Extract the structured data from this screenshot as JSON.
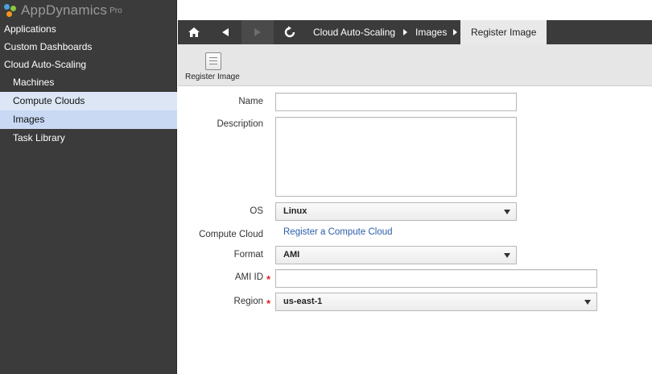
{
  "app": {
    "name": "AppDynamics",
    "edition": "Pro"
  },
  "sidebar": {
    "items": [
      {
        "label": "Applications"
      },
      {
        "label": "Custom Dashboards"
      },
      {
        "label": "Cloud Auto-Scaling"
      },
      {
        "label": "Machines"
      },
      {
        "label": "Compute Clouds"
      },
      {
        "label": "Images"
      },
      {
        "label": "Task Library"
      }
    ]
  },
  "topbar": {
    "icons": {
      "home": "home-icon",
      "back": "back-arrow-icon",
      "forward": "forward-arrow-icon",
      "refresh": "refresh-icon"
    },
    "breadcrumbs": [
      "Cloud Auto-Scaling",
      "Images",
      "Register Image"
    ]
  },
  "toolbar": {
    "register_label": "Register Image",
    "register_icon": "save-document-icon"
  },
  "form": {
    "name_label": "Name",
    "description_label": "Description",
    "os_label": "OS",
    "os_value": "Linux",
    "compute_cloud_label": "Compute Cloud",
    "compute_cloud_link": "Register a Compute Cloud",
    "format_label": "Format",
    "format_value": "AMI",
    "ami_id_label": "AMI ID",
    "region_label": "Region",
    "region_value": "us-east-1",
    "required_marker": "*"
  },
  "colors": {
    "sidebar_bg": "#3b3b3b",
    "selected_bg": "#c9d8f3",
    "link": "#2a5ea8",
    "required": "#dd2222"
  }
}
